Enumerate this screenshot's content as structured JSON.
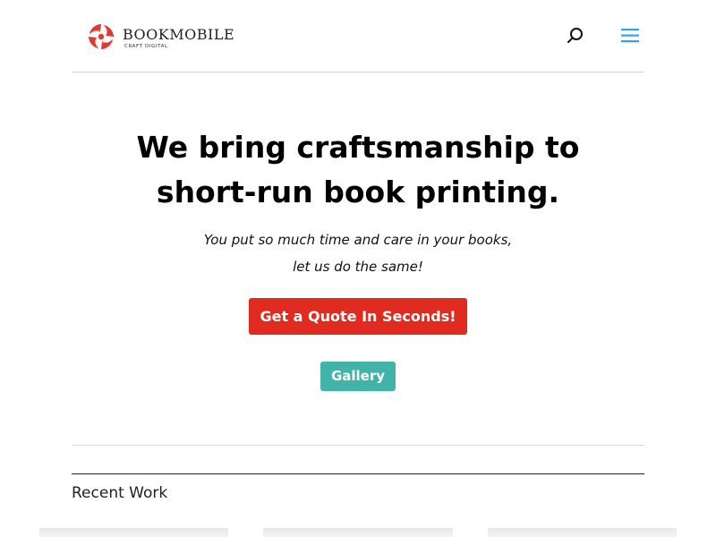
{
  "header": {
    "logo": {
      "wordmark": "BOOKMOBILE",
      "tagline": "CRAFT DIGITAL",
      "mark_color": "#e03a2f"
    },
    "search_icon": "search-icon",
    "menu_icon": "hamburger-menu-icon",
    "accent_color": "#2ea3f2"
  },
  "hero": {
    "title_line1": "We bring craftsmanship to",
    "title_line2": "short-run book printing.",
    "subtitle_line1": "You put so much time and care in your books,",
    "subtitle_line2": "let us do the same!",
    "quote_button_label": "Get a Quote In Seconds!",
    "quote_button_color": "#e02b20",
    "gallery_button_label": "Gallery",
    "gallery_button_color": "#42b3a9"
  },
  "recent_work": {
    "heading": "Recent Work",
    "items": [
      {
        "kind": "thumbnail"
      },
      {
        "kind": "thumbnail"
      },
      {
        "kind": "thumbnail"
      }
    ]
  }
}
